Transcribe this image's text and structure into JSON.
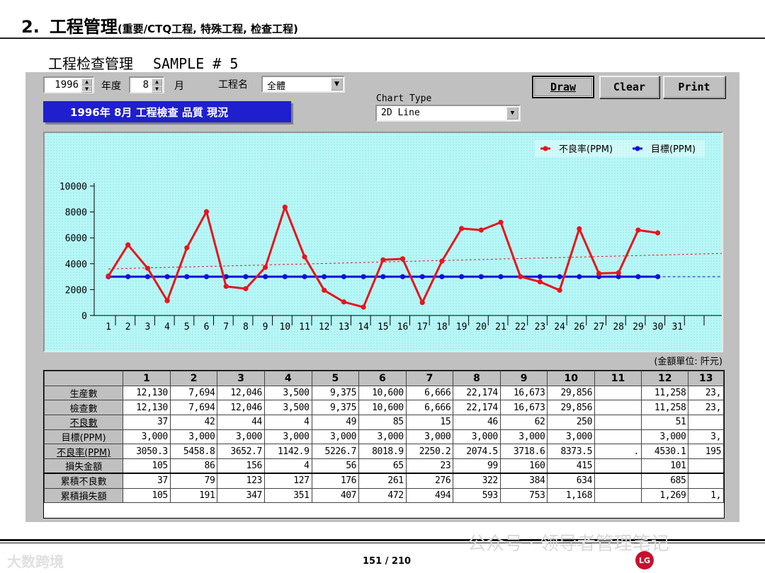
{
  "slide": {
    "number": "2.",
    "title": "工程管理",
    "subtitle": "(重要/CTQ工程, 特殊工程, 检查工程)",
    "panel_title": "工程检查管理",
    "panel_sample": "SAMPLE # 5",
    "page": "151 / 210",
    "watermark_1": "公众号 · 领导者管理笔记",
    "watermark_2": "大数跨境",
    "logo_text": "LG"
  },
  "controls": {
    "year_value": "1996",
    "year_label": "年度",
    "month_value": "8",
    "month_label": "月",
    "process_label": "工程名",
    "process_value": "全體",
    "chart_type_label": "Chart Type",
    "chart_type_value": "2D Line",
    "banner": "1996年  8月   工程檢查   品質 現況",
    "draw": "Draw",
    "clear": "Clear",
    "print": "Print",
    "unit_note": "(金額單位: 阡元)"
  },
  "icons": {
    "spin": "spin-arrows-icon",
    "dropdown": "dropdown-arrow-icon"
  },
  "colors": {
    "defect_rate": "#e8141c",
    "target": "#1010d8",
    "chart_bg": "#b8f7f7",
    "banner_bg": "#1f1fd0",
    "window_bg": "#c0c0c0"
  },
  "chart_data": {
    "type": "line",
    "x": [
      "1",
      "2",
      "3",
      "4",
      "5",
      "6",
      "7",
      "8",
      "9",
      "10",
      "11",
      "12",
      "13",
      "14",
      "15",
      "16",
      "17",
      "18",
      "19",
      "20",
      "21",
      "22",
      "23",
      "24",
      "26",
      "27",
      "28",
      "29",
      "30",
      "31"
    ],
    "series": [
      {
        "name": "不良率(PPM)",
        "color": "#e8141c",
        "values": [
          3050,
          5460,
          3650,
          1140,
          5230,
          8020,
          2250,
          2070,
          3720,
          8370,
          4530,
          1950,
          1050,
          650,
          4300,
          4380,
          1000,
          4200,
          6720,
          6600,
          7200,
          3000,
          2600,
          1950,
          6700,
          3250,
          3300,
          6600,
          6380
        ]
      },
      {
        "name": "目標(PPM)",
        "color": "#1010d8",
        "values": [
          3000,
          3000,
          3000,
          3000,
          3000,
          3000,
          3000,
          3000,
          3000,
          3000,
          3000,
          3000,
          3000,
          3000,
          3000,
          3000,
          3000,
          3000,
          3000,
          3000,
          3000,
          3000,
          3000,
          3000,
          3000,
          3000,
          3000,
          3000,
          3000
        ]
      }
    ],
    "trend_start": 3600,
    "trend_end": 4800,
    "ylim": [
      0,
      10000
    ],
    "yticks": [
      0,
      2000,
      4000,
      6000,
      8000,
      10000
    ],
    "legend_position": "top-right",
    "grid": false
  },
  "table": {
    "columns": [
      "1",
      "2",
      "3",
      "4",
      "5",
      "6",
      "7",
      "8",
      "9",
      "10",
      "11",
      "12",
      "13"
    ],
    "rows": [
      {
        "label": "生産數",
        "underline": false,
        "values": [
          "12,130",
          "7,694",
          "12,046",
          "3,500",
          "9,375",
          "10,600",
          "6,666",
          "22,174",
          "16,673",
          "29,856",
          "",
          "11,258",
          "23,"
        ]
      },
      {
        "label": "檢查數",
        "underline": false,
        "values": [
          "12,130",
          "7,694",
          "12,046",
          "3,500",
          "9,375",
          "10,600",
          "6,666",
          "22,174",
          "16,673",
          "29,856",
          "",
          "11,258",
          "23,"
        ]
      },
      {
        "label": "不良數",
        "underline": true,
        "values": [
          "37",
          "42",
          "44",
          "4",
          "49",
          "85",
          "15",
          "46",
          "62",
          "250",
          "",
          "51",
          ""
        ]
      },
      {
        "label": "目標(PPM)",
        "underline": false,
        "values": [
          "3,000",
          "3,000",
          "3,000",
          "3,000",
          "3,000",
          "3,000",
          "3,000",
          "3,000",
          "3,000",
          "3,000",
          "",
          "3,000",
          "3,"
        ]
      },
      {
        "label": "不良率(PPM)",
        "underline": true,
        "values": [
          "3050.3",
          "5458.8",
          "3652.7",
          "1142.9",
          "5226.7",
          "8018.9",
          "2250.2",
          "2074.5",
          "3718.6",
          "8373.5",
          ".",
          "4530.1",
          "195"
        ]
      },
      {
        "label": "損失金額",
        "underline": false,
        "values": [
          "105",
          "86",
          "156",
          "4",
          "56",
          "65",
          "23",
          "99",
          "160",
          "415",
          "",
          "101",
          ""
        ]
      },
      {
        "label": "累積不良數",
        "underline": false,
        "values": [
          "37",
          "79",
          "123",
          "127",
          "176",
          "261",
          "276",
          "322",
          "384",
          "634",
          "",
          "685",
          ""
        ]
      },
      {
        "label": "累積損失額",
        "underline": false,
        "values": [
          "105",
          "191",
          "347",
          "351",
          "407",
          "472",
          "494",
          "593",
          "753",
          "1,168",
          "",
          "1,269",
          "1,"
        ]
      }
    ]
  }
}
